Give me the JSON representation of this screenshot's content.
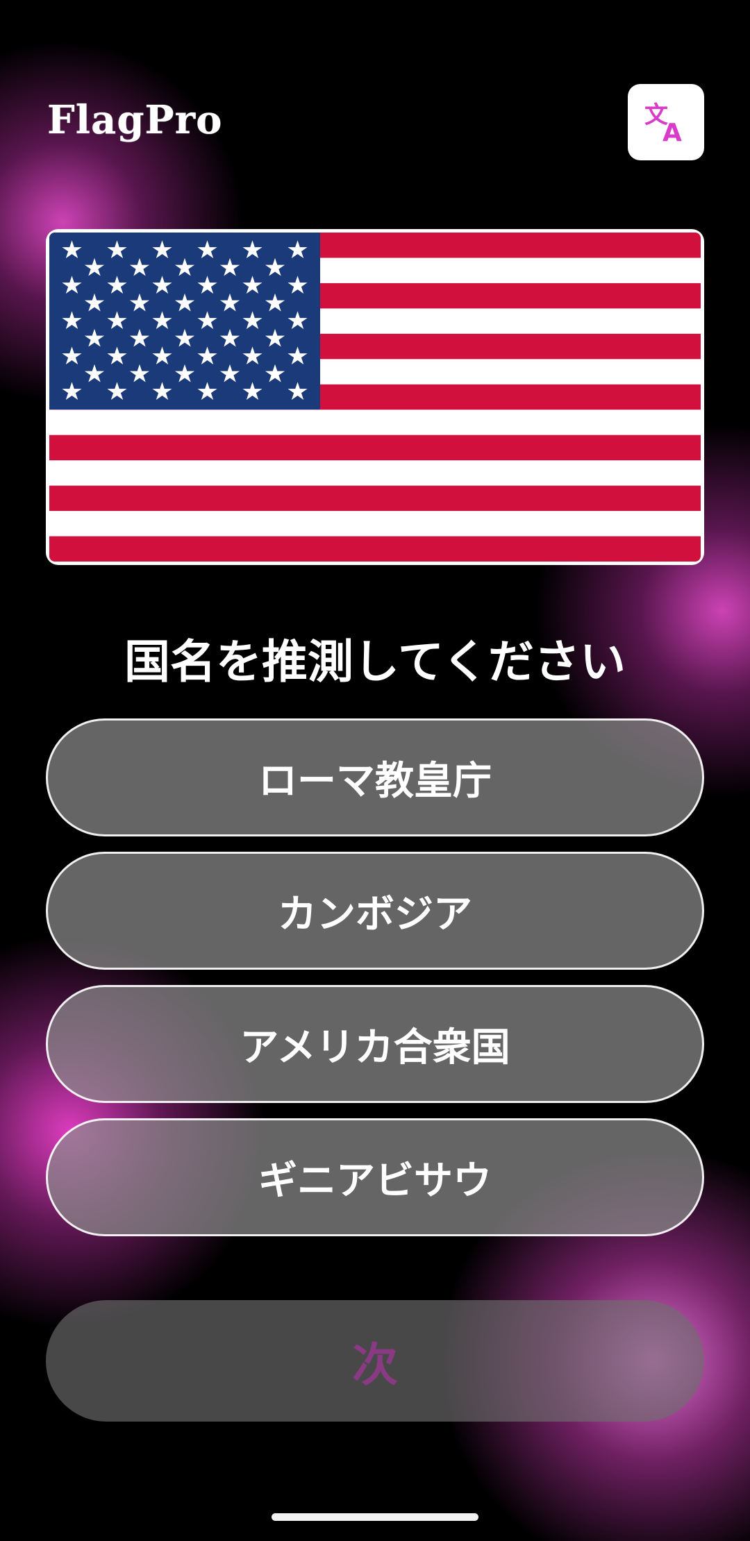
{
  "app": {
    "title": "FlagPro"
  },
  "header": {
    "language_icon": "translate-icon",
    "language_icon_glyph": "文A"
  },
  "flag": {
    "country_shown": "United States",
    "colors": {
      "red": "#D2103E",
      "white": "#FFFFFF",
      "blue": "#1B3A7A"
    }
  },
  "quiz": {
    "question": "国名を推測してください",
    "options": [
      {
        "label": "ローマ教皇庁"
      },
      {
        "label": "カンボジア"
      },
      {
        "label": "アメリカ合衆国"
      },
      {
        "label": "ギニアビサウ"
      }
    ],
    "next_label": "次"
  },
  "theme": {
    "accent": "#D83CC8",
    "background": "#000000",
    "option_fill": "#8C8C8C"
  }
}
